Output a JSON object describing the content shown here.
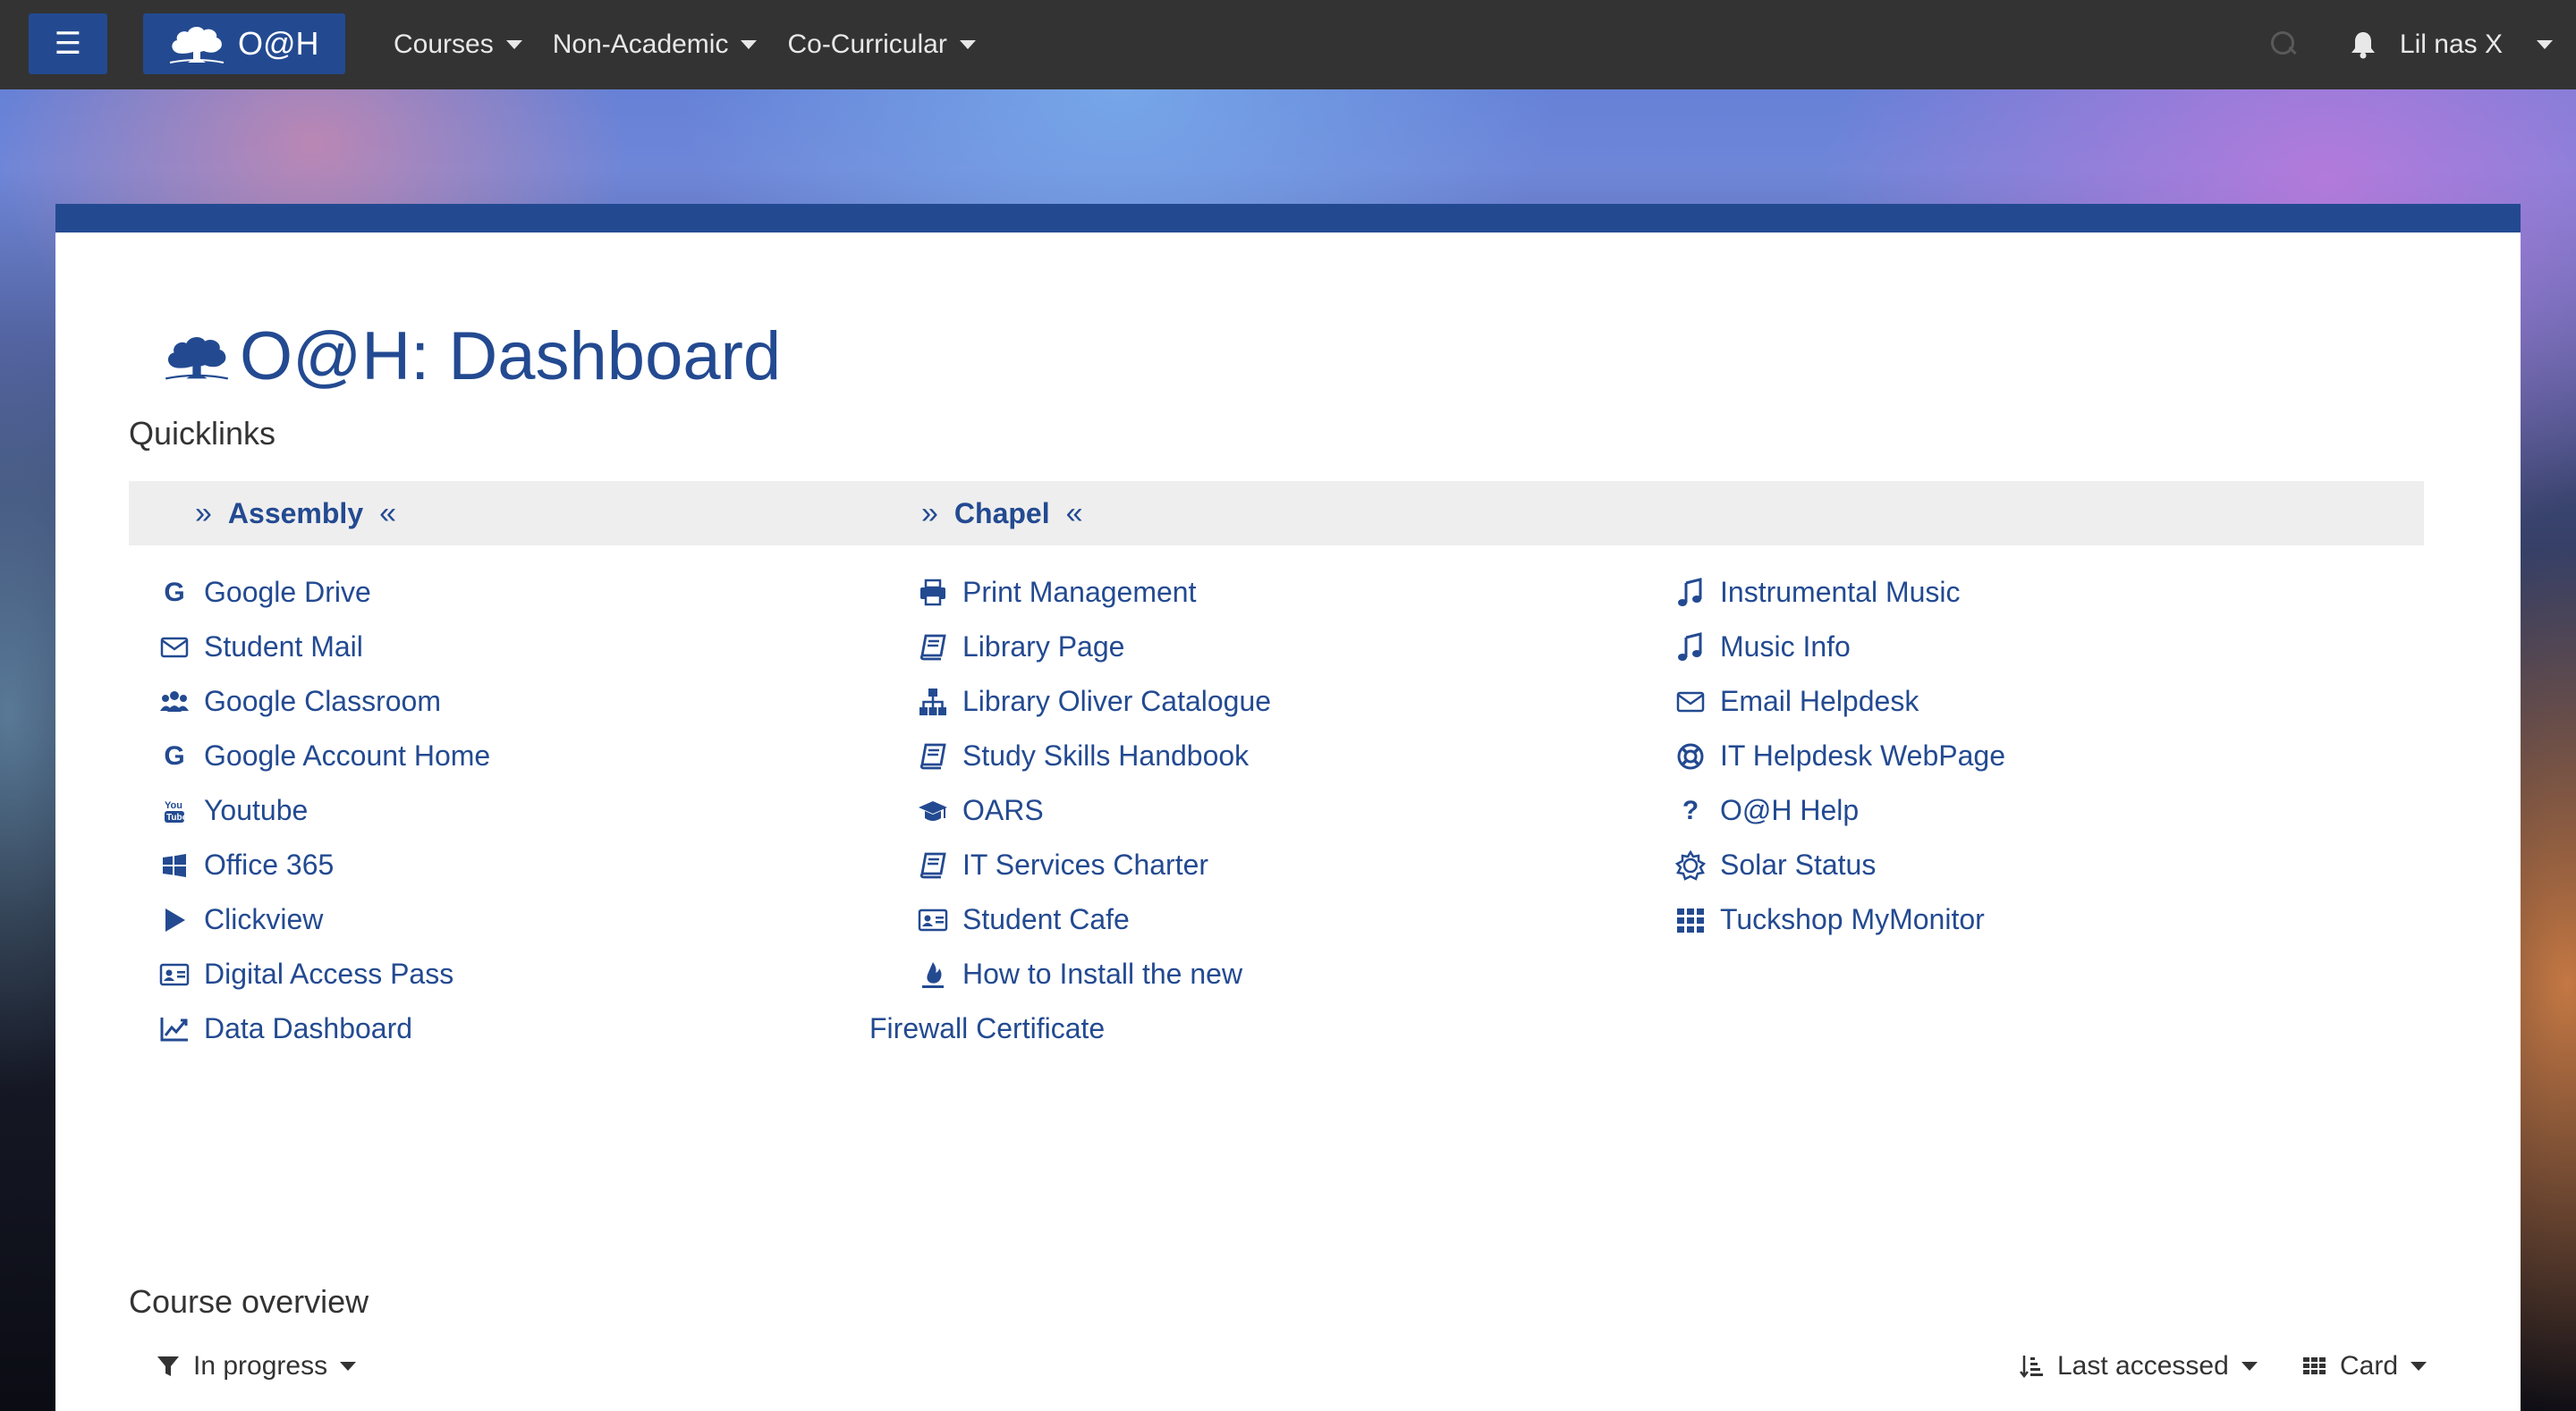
{
  "navbar": {
    "menu_icon": "hamburger-icon",
    "brand_text": "O@H",
    "menus": [
      {
        "label": "Courses"
      },
      {
        "label": "Non-Academic"
      },
      {
        "label": "Co-Curricular"
      }
    ],
    "user_name": "Lil nas X"
  },
  "page": {
    "title": "O@H: Dashboard"
  },
  "quicklinks": {
    "title": "Quicklinks",
    "headers": [
      {
        "label": "Assembly"
      },
      {
        "label": "Chapel"
      }
    ],
    "columns": [
      [
        {
          "label": "Google Drive",
          "icon": "google-icon"
        },
        {
          "label": "Student Mail",
          "icon": "mail-icon"
        },
        {
          "label": "Google Classroom",
          "icon": "users-icon"
        },
        {
          "label": "Google Account Home",
          "icon": "google-icon"
        },
        {
          "label": "Youtube",
          "icon": "youtube-icon"
        },
        {
          "label": "Office 365",
          "icon": "windows-icon"
        },
        {
          "label": "Clickview",
          "icon": "play-icon"
        },
        {
          "label": "Digital Access Pass",
          "icon": "id-card-icon"
        },
        {
          "label": "Data Dashboard",
          "icon": "chart-line-icon"
        }
      ],
      [
        {
          "label": "Print Management",
          "icon": "printer-icon"
        },
        {
          "label": "Library Page",
          "icon": "book-icon"
        },
        {
          "label": "Library Oliver Catalogue",
          "icon": "sitemap-icon"
        },
        {
          "label": "Study Skills Handbook",
          "icon": "book-icon"
        },
        {
          "label": "OARS",
          "icon": "graduation-cap-icon"
        },
        {
          "label": "IT Services Charter",
          "icon": "book-icon"
        },
        {
          "label": "Student Cafe",
          "icon": "id-card-icon"
        },
        {
          "label": "How to Install the new",
          "icon": "fire-icon",
          "continuation": "Firewall Certificate"
        }
      ],
      [
        {
          "label": "Instrumental Music",
          "icon": "music-icon"
        },
        {
          "label": "Music Info",
          "icon": "music-icon"
        },
        {
          "label": "Email Helpdesk",
          "icon": "mail-icon"
        },
        {
          "label": "IT Helpdesk WebPage",
          "icon": "life-ring-icon"
        },
        {
          "label": "O@H Help",
          "icon": "question-icon"
        },
        {
          "label": "Solar Status",
          "icon": "sun-icon"
        },
        {
          "label": "Tuckshop MyMonitor",
          "icon": "grid-icon"
        }
      ]
    ]
  },
  "course_overview": {
    "title": "Course overview",
    "filter_label": "In progress",
    "sort_label": "Last accessed",
    "view_label": "Card"
  },
  "colors": {
    "brand": "#234a91",
    "navbar": "#333333",
    "header_band": "#eeeeee",
    "thumb_yellow": "#d9d34a"
  }
}
